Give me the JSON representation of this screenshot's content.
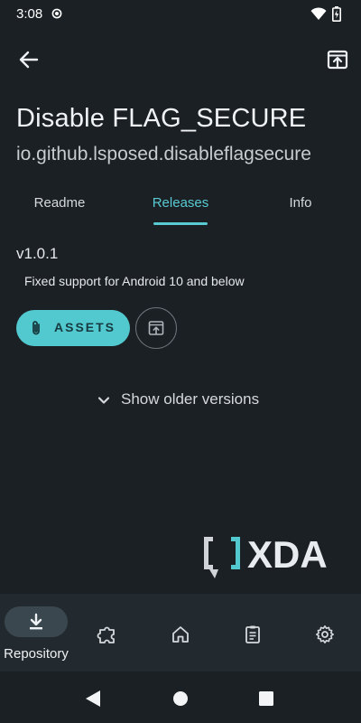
{
  "status_bar": {
    "time": "3:08"
  },
  "app": {
    "title": "Disable FLAG_SECURE",
    "package": "io.github.lsposed.disableflagsecure"
  },
  "tabs": [
    {
      "label": "Readme"
    },
    {
      "label": "Releases",
      "active": true
    },
    {
      "label": "Info"
    }
  ],
  "release": {
    "version": "v1.0.1",
    "note": "Fixed support for Android 10 and below",
    "assets_label": "ASSETS"
  },
  "older_versions_label": "Show older versions",
  "watermark": "XDA",
  "bottom_nav": [
    {
      "label": "Repository",
      "icon": "download-icon",
      "selected": true
    },
    {
      "label": "",
      "icon": "puzzle-icon"
    },
    {
      "label": "",
      "icon": "home-icon"
    },
    {
      "label": "",
      "icon": "clipboard-icon"
    },
    {
      "label": "",
      "icon": "gear-icon"
    }
  ],
  "colors": {
    "background": "#1b2025",
    "accent": "#57cbd1",
    "button_fill": "#52c9ce",
    "nav_background": "#232a2f"
  }
}
